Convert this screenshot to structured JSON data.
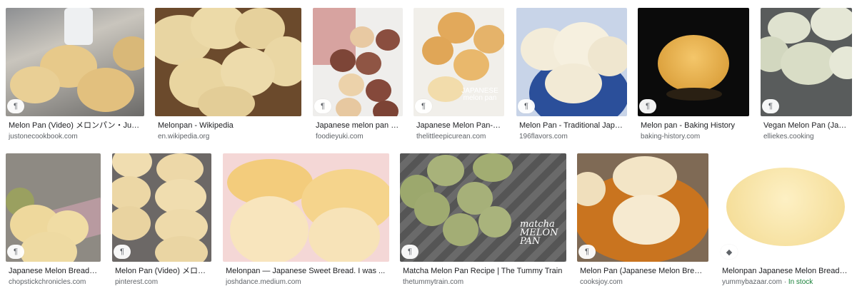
{
  "results": [
    {
      "title": "Melon Pan (Video) メロンパン・Just ...",
      "source": "justonecookbook.com",
      "icon": "recipe-icon"
    },
    {
      "title": "Melonpan - Wikipedia",
      "source": "en.wikipedia.org",
      "icon": ""
    },
    {
      "title": "Japanese melon pan – ...",
      "source": "foodieyuki.com",
      "icon": "recipe-icon"
    },
    {
      "title": "Japanese Melon Pan- T...",
      "source": "thelittleepicurean.com",
      "icon": "recipe-icon",
      "overlay": "JAPANESE melon pan"
    },
    {
      "title": "Melon Pan - Traditional Japan...",
      "source": "196flavors.com",
      "icon": "recipe-icon"
    },
    {
      "title": "Melon pan - Baking History",
      "source": "baking-history.com",
      "icon": "recipe-icon"
    },
    {
      "title": "Vegan Melon Pan (Jap...",
      "source": "elliekes.cooking",
      "icon": "recipe-icon"
    },
    {
      "title": "Japanese Melon Bread | ...",
      "source": "chopstickchronicles.com",
      "icon": "recipe-icon"
    },
    {
      "title": "Melon Pan (Video) メロン...",
      "source": "pinterest.com",
      "icon": "recipe-icon"
    },
    {
      "title": "Melonpan — Japanese Sweet Bread. I was ...",
      "source": "joshdance.medium.com",
      "icon": ""
    },
    {
      "title": "Matcha Melon Pan Recipe | The Tummy Train",
      "source": "thetummytrain.com",
      "icon": "recipe-icon",
      "overlay": "matcha MELON PAN"
    },
    {
      "title": "Melon Pan (Japanese Melon Bread ...",
      "source": "cooksjoy.com",
      "icon": "recipe-icon"
    },
    {
      "title": "Melonpan Japanese Melon Bread b...",
      "source": "yummybazaar.com",
      "stock": "In stock",
      "icon": "tag-icon"
    }
  ],
  "icons": {
    "recipe": "¶",
    "tag": "◆"
  },
  "separator": " · ",
  "colors": {
    "title": "#202124",
    "source": "#5f6368",
    "stock": "#188038"
  }
}
